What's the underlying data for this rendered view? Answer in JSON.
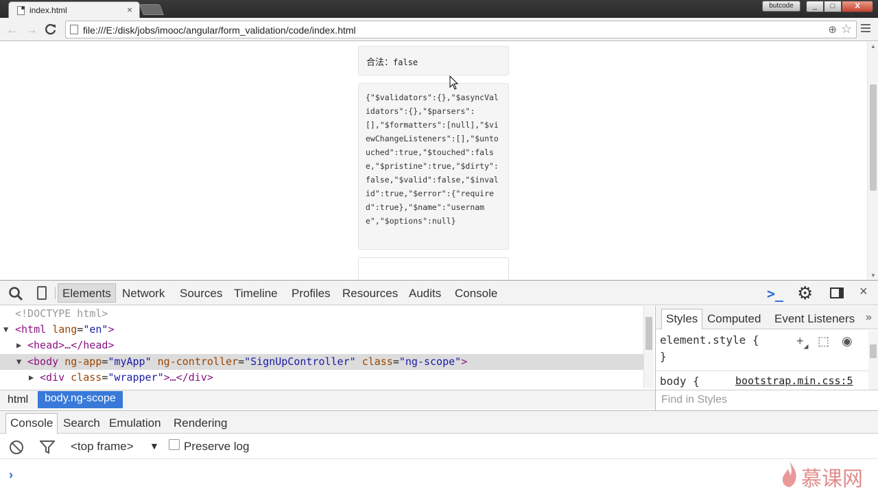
{
  "browser": {
    "tab_title": "index.html",
    "tab_close": "×",
    "user_badge": "butcode",
    "window_min": "_",
    "window_max": "□",
    "window_close": "X",
    "back": "←",
    "forward": "→",
    "reload": "C",
    "url": "file:///E:/disk/jobs/imooc/angular/form_validation/code/index.html",
    "zoom_glyph": "⊕",
    "star_glyph": "☆"
  },
  "page": {
    "valid_label": "合法：",
    "valid_value": "false",
    "json_text": "{\"$validators\":{},\"$asyncValidators\":{},\"$parsers\":[],\"$formatters\":[null],\"$viewChangeListeners\":[],\"$untouched\":true,\"$touched\":false,\"$pristine\":true,\"$dirty\":false,\"$valid\":false,\"$invalid\":true,\"$error\":{\"required\":true},\"$name\":\"username\",\"$options\":null}"
  },
  "devtools": {
    "tabs": [
      "Elements",
      "Network",
      "Sources",
      "Timeline",
      "Profiles",
      "Resources",
      "Audits",
      "Console"
    ],
    "close": "×",
    "dom": {
      "doctype": "<!DOCTYPE html>",
      "html_tag": "<html",
      "html_attr": "lang",
      "html_val": "\"en\"",
      "html_close": ">",
      "head": "<head>…</head>",
      "body_open": "<body",
      "body_attr1": "ng-app",
      "body_val1": "\"myApp\"",
      "body_attr2": "ng-controller",
      "body_val2": "\"SignUpController\"",
      "body_attr3": "class",
      "body_val3": "\"ng-scope\"",
      "body_close": ">",
      "div_open": "<div",
      "div_attr": "class",
      "div_val": "\"wrapper\"",
      "div_close": ">…</div>",
      "eq": "="
    },
    "breadcrumbs": [
      "html",
      "body.ng-scope"
    ],
    "styles": {
      "tabs": [
        "Styles",
        "Computed",
        "Event Listeners"
      ],
      "more": "»",
      "element_style_open": "element.style {",
      "element_style_close": "}",
      "body_rule": "body {",
      "body_source": "bootstrap.min.css:5",
      "find_placeholder": "Find in Styles"
    },
    "drawer": {
      "tabs": [
        "Console",
        "Search",
        "Emulation",
        "Rendering"
      ],
      "frame": "<top frame>",
      "frame_arrow": "▼",
      "preserve_log": "Preserve log",
      "prompt": "›"
    }
  },
  "watermark": {
    "text": "慕课网"
  },
  "colors": {
    "accent": "#3879d9",
    "tag": "#881280",
    "attr": "#994500",
    "value": "#1a1aa6"
  }
}
